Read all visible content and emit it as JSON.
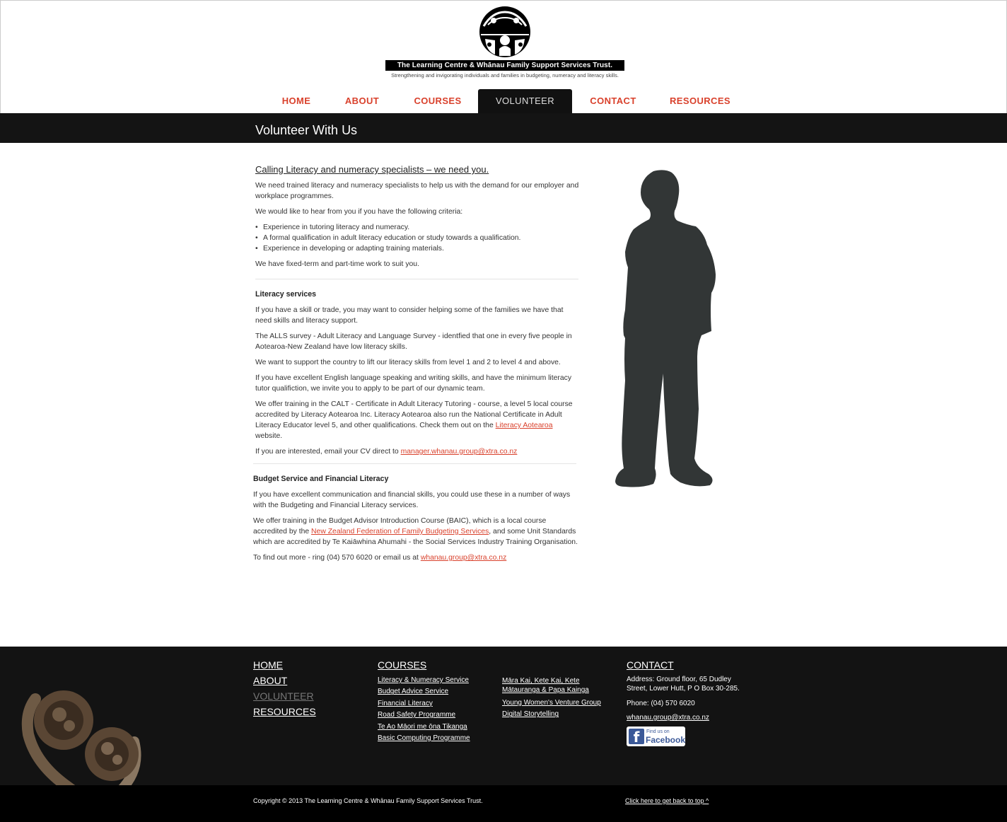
{
  "header": {
    "logo_title": "The Learning Centre & Whānau Family Support Services Trust.",
    "tagline": "Strengthening and invigorating individuals and families in budgeting, numeracy and literacy skills."
  },
  "nav": {
    "items": [
      {
        "label": "HOME"
      },
      {
        "label": "ABOUT"
      },
      {
        "label": "COURSES"
      },
      {
        "label": "VOLUNTEER"
      },
      {
        "label": "CONTACT"
      },
      {
        "label": "RESOURCES"
      }
    ],
    "active": "VOLUNTEER"
  },
  "page_title": "Volunteer With Us",
  "content": {
    "heading": "Calling Literacy and numeracy specialists – we need you.",
    "p1": "We need trained literacy and numeracy specialists to help us with the demand for our employer and workplace programmes.",
    "p2": "We would like to hear from you if you have the following criteria:",
    "criteria": [
      "Experience in tutoring literacy and numeracy.",
      "A formal qualification in adult literacy education or study towards a qualification.",
      "Experience in developing or adapting training materials."
    ],
    "p3": "We have fixed-term and part-time work to suit you.",
    "literacy": {
      "heading": "Literacy services",
      "p1": "If you have a skill or trade, you may want to consider helping some of the families we have that need skills and literacy support.",
      "p2": "The ALLS survey - Adult Literacy and Language Survey - identfied that one in every five people in Aotearoa-New Zealand have low literacy skills.",
      "p3": "We want to support the country to lift our literacy skills from level 1 and 2 to level 4 and above.",
      "p4": "If you have excellent English language speaking and writing skills, and have the minimum literacy tutor qualifiction, we invite you to apply to be part of our dynamic team.",
      "p5_before": "We offer training in the CALT - Certificate in Adult Literacy Tutoring - course, a level 5 local course accredited by Literacy Aotearoa Inc. Literacy Aotearoa also run the National Certificate in Adult Literacy Educator level 5, and other qualifications. Check them out on the ",
      "p5_link": "Literacy Aotearoa",
      "p5_after": " website.",
      "p6_before": "If you are interested, email your CV direct to ",
      "p6_link": "manager.whanau.group@xtra.co.nz"
    },
    "budget": {
      "heading": "Budget Service and Financial Literacy",
      "p1": "If you have excellent communication and financial skills, you could use these in a number of ways with the Budgeting and Financial Literacy services.",
      "p2_before": "We offer training in the Budget Advisor Introduction Course (BAIC), which is a local course accredited by the ",
      "p2_link": "New Zealand Federation of Family Budgeting Services",
      "p2_after": ", and some Unit Standards which are accredited by Te Kaiāwhina Ahumahi - the Social Services Industry Training Organisation.",
      "p3_before": "To find out more - ring (04) 570 6020 or email us at ",
      "p3_link": "whanau.group@xtra.co.nz"
    }
  },
  "footer": {
    "main_links": [
      "HOME",
      "ABOUT",
      "VOLUNTEER",
      "RESOURCES"
    ],
    "courses_heading": "COURSES",
    "courses_col1": [
      "Literacy & Numeracy Service",
      "Budget Advice Service",
      "Financial Literacy",
      "Road Safety Programme",
      "Te Ao Māori me ōna Tikanga",
      "Basic Computing Programme"
    ],
    "courses_col2": [
      "Māra Kai, Kete Kai, Kete Mātauranga & Papa Kainga",
      "Young Women's Venture Group",
      "Digital Storytelling"
    ],
    "contact_heading": "CONTACT",
    "address": "Address: Ground floor, 65 Dudley Street, Lower Hutt, P O Box 30-285.",
    "phone": "Phone: (04) 570 6020",
    "email": "whanau.group@xtra.co.nz",
    "facebook_small": "Find us on",
    "facebook_big": "Facebook",
    "copyright": "Copyright © 2013 The Learning Centre & Whānau Family Support Services Trust.",
    "back_to_top": "Click here to get back to top ^"
  },
  "colors": {
    "accent": "#d9412c",
    "dark_bar": "#141414",
    "silhouette": "#323636",
    "facebook": "#3b5998"
  }
}
